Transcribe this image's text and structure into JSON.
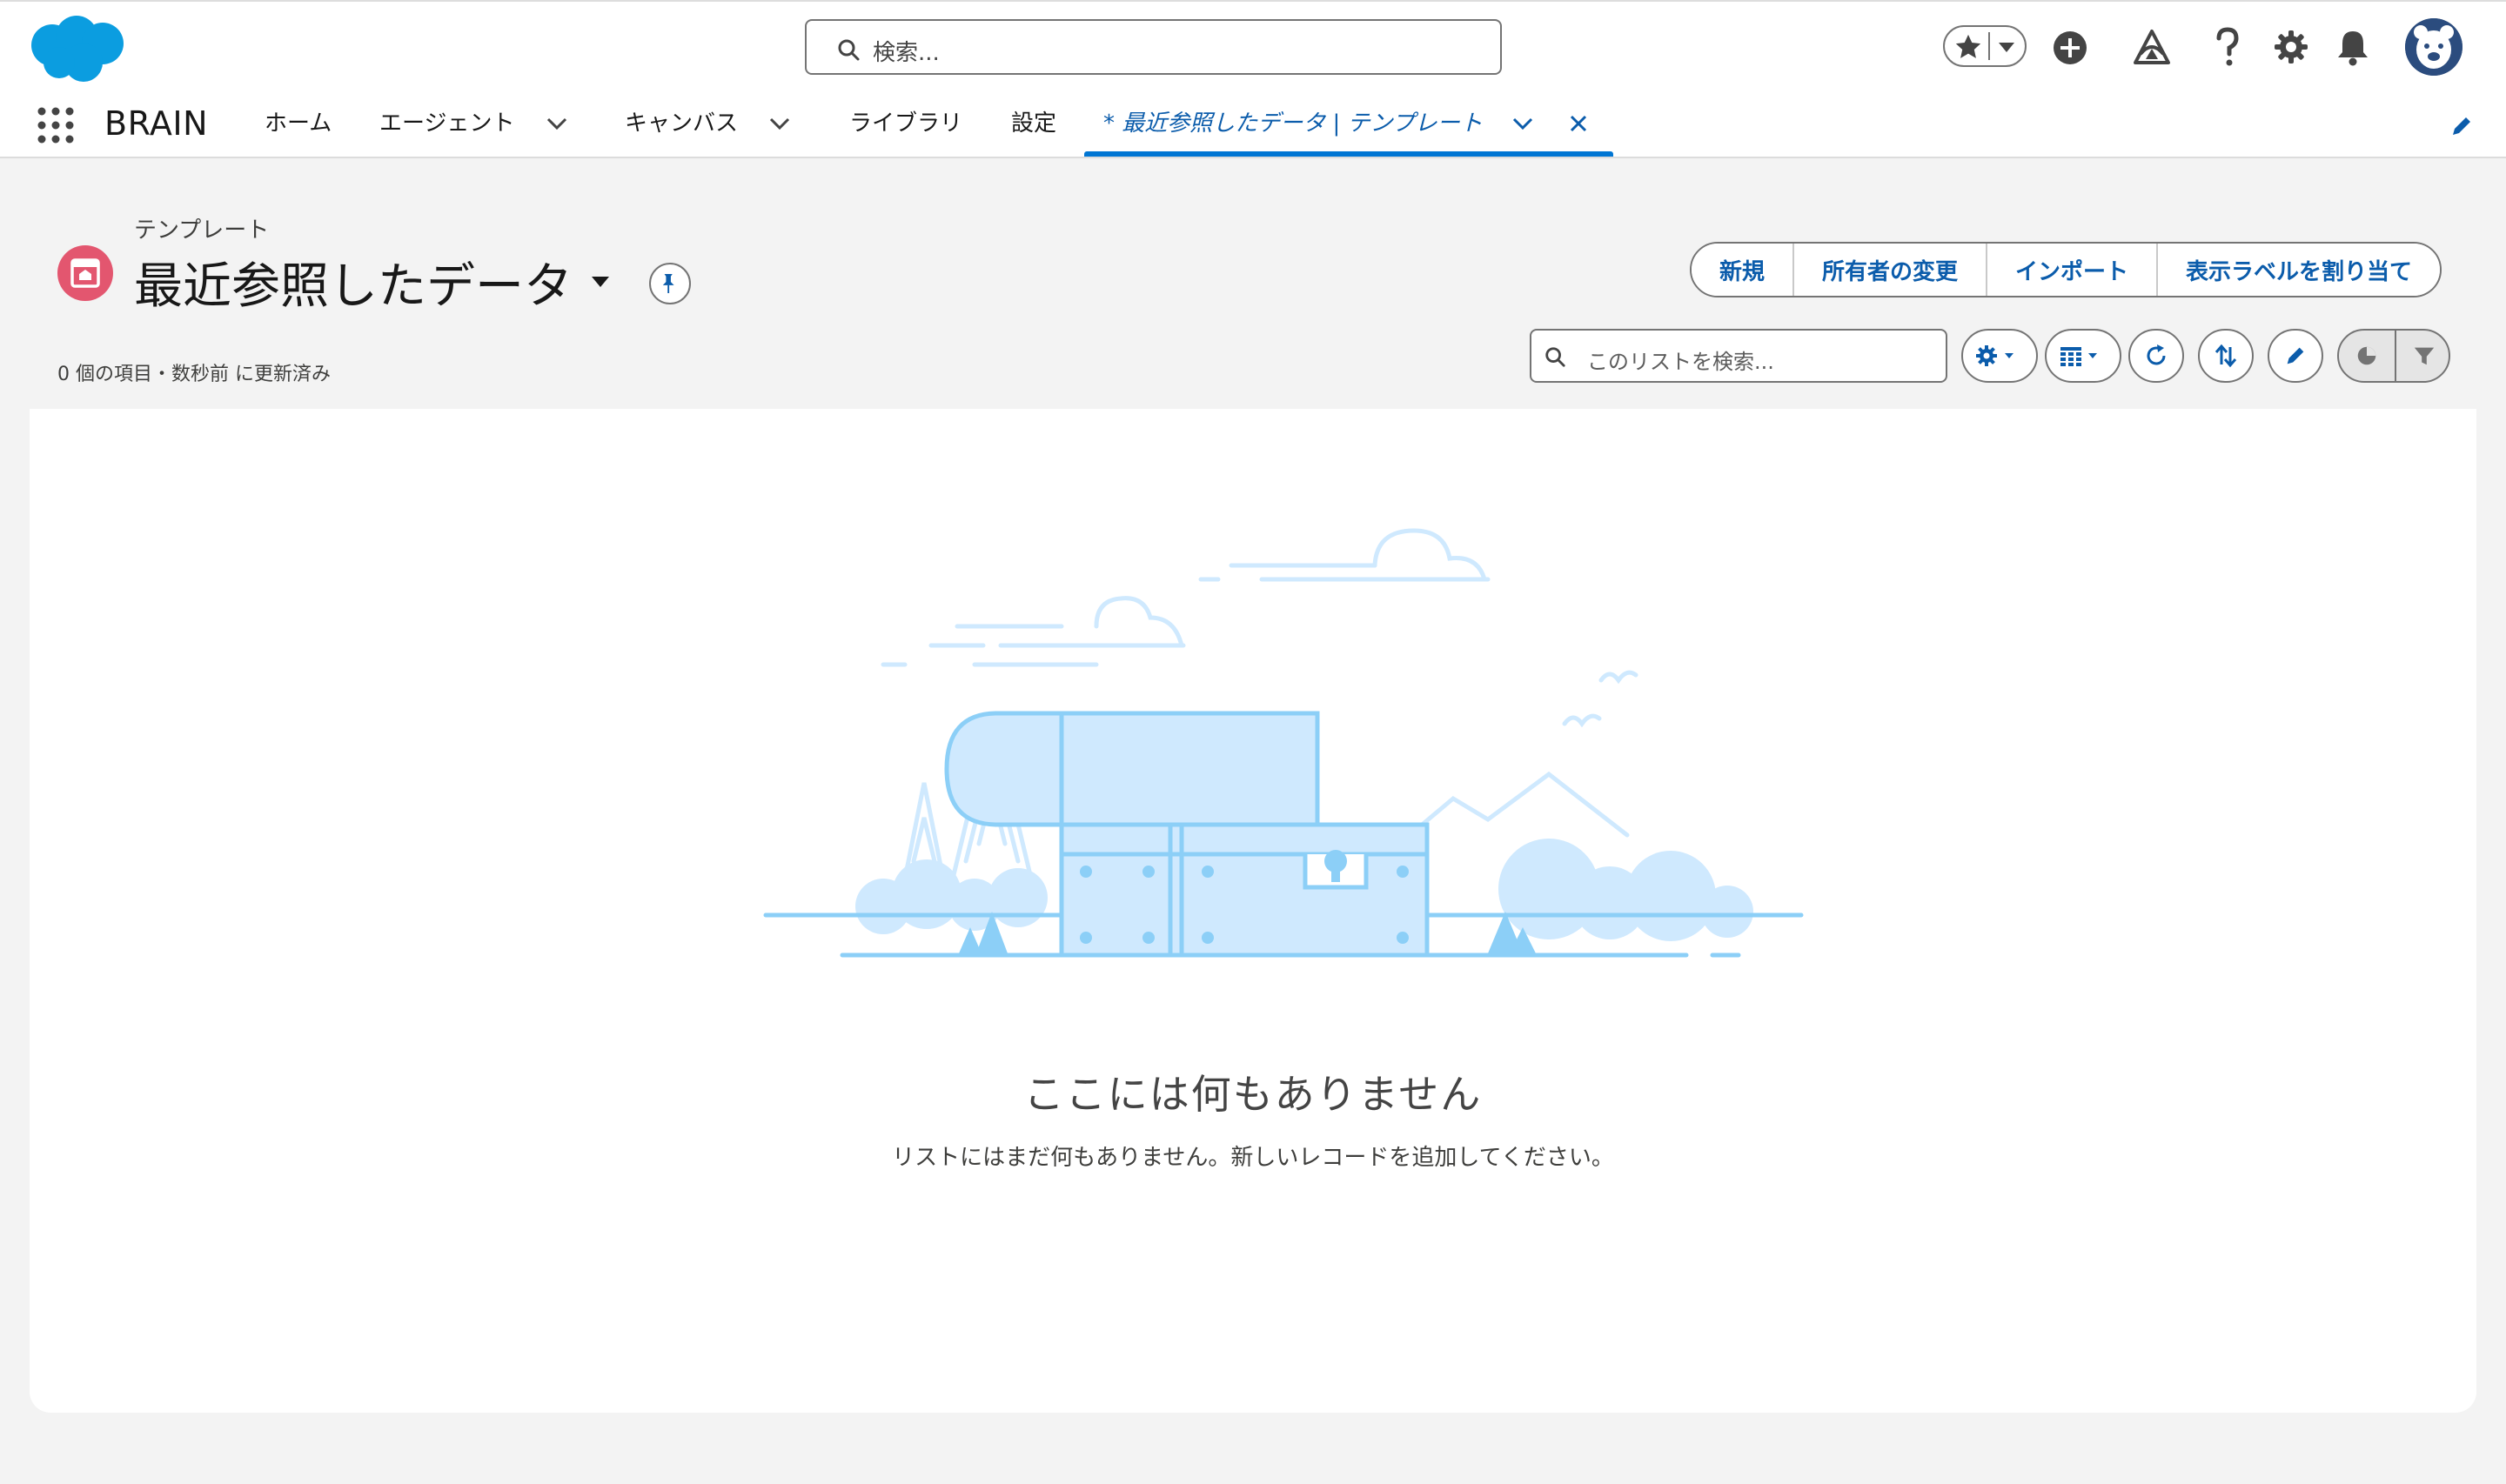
{
  "global_header": {
    "search_placeholder": "検索...",
    "icons": [
      "favorites-star-icon",
      "favorites-menu-icon",
      "add-icon",
      "trailhead-icon",
      "help-icon",
      "setup-gear-icon",
      "notifications-bell-icon",
      "user-avatar-icon"
    ]
  },
  "app_nav": {
    "app_name": "BRAIN",
    "items": [
      {
        "label": "ホーム",
        "has_menu": false
      },
      {
        "label": "エージェント",
        "has_menu": true
      },
      {
        "label": "キャンバス",
        "has_menu": true
      },
      {
        "label": "ライブラリ",
        "has_menu": false
      },
      {
        "label": "設定",
        "has_menu": false
      }
    ],
    "active_tab": {
      "label": "* 最近参照したデータ | テンプレート"
    }
  },
  "list_view": {
    "object_label": "テンプレート",
    "title": "最近参照したデータ",
    "status": "0 個の項目・数秒前 に更新済み",
    "actions": [
      "新規",
      "所有者の変更",
      "インポート",
      "表示ラベルを割り当て"
    ],
    "search_placeholder": "このリストを検索...",
    "tools": [
      "list-view-controls-icon",
      "display-as-table-icon",
      "refresh-icon",
      "sort-icon",
      "inline-edit-icon",
      "charts-icon",
      "filter-icon"
    ]
  },
  "empty_state": {
    "title": "ここには何もありません",
    "subtitle": "リストにはまだ何もありません。新しいレコードを追加してください。"
  },
  "colors": {
    "brand_blue": "#0176d3",
    "link_blue": "#0b5cab",
    "object_icon": "#e3566f",
    "illustration_fill": "#cfe9fe",
    "illustration_stroke": "#8ccff7"
  }
}
